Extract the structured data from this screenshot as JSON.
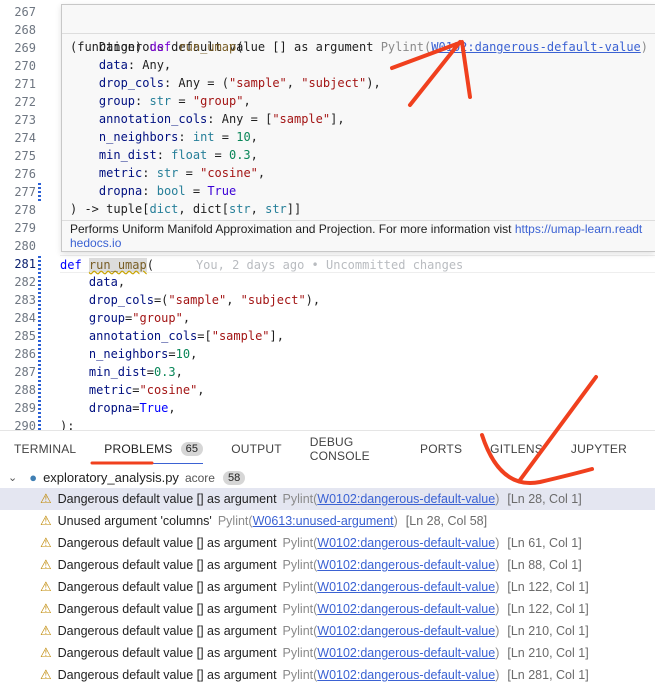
{
  "gutter": {
    "line_numbers": [
      "267",
      "268",
      "269",
      "270",
      "271",
      "272",
      "273",
      "274",
      "275",
      "276",
      "277",
      "278",
      "279",
      "280",
      "281",
      "282",
      "283",
      "284",
      "285",
      "286",
      "287",
      "288",
      "289",
      "290"
    ],
    "current_line": "281"
  },
  "hover": {
    "message": "Dangerous default value [] as argument",
    "source": "Pylint(",
    "code_link": "W0102:dangerous-default-value",
    "source_close": ")",
    "signature": [
      [
        [
          "(function) ",
          "pun"
        ],
        [
          "def",
          "kwh"
        ],
        [
          " ",
          "pun"
        ],
        [
          "run_umap",
          "fn"
        ],
        [
          "(",
          "pun"
        ]
      ],
      [
        [
          "    ",
          "pun"
        ],
        [
          "data",
          "pa"
        ],
        [
          ": Any,",
          "pun"
        ]
      ],
      [
        [
          "    ",
          "pun"
        ],
        [
          "drop_cols",
          "pa"
        ],
        [
          ": Any = (",
          "pun"
        ],
        [
          "\"sample\"",
          "str"
        ],
        [
          ", ",
          "pun"
        ],
        [
          "\"subject\"",
          "str"
        ],
        [
          "),",
          "pun"
        ]
      ],
      [
        [
          "    ",
          "pun"
        ],
        [
          "group",
          "pa"
        ],
        [
          ": ",
          "pun"
        ],
        [
          "str",
          "ty"
        ],
        [
          " = ",
          "pun"
        ],
        [
          "\"group\"",
          "str"
        ],
        [
          ",",
          "pun"
        ]
      ],
      [
        [
          "    ",
          "pun"
        ],
        [
          "annotation_cols",
          "pa"
        ],
        [
          ": Any = [",
          "pun"
        ],
        [
          "\"sample\"",
          "str"
        ],
        [
          "],",
          "pun"
        ]
      ],
      [
        [
          "    ",
          "pun"
        ],
        [
          "n_neighbors",
          "pa"
        ],
        [
          ": ",
          "pun"
        ],
        [
          "int",
          "ty"
        ],
        [
          " = ",
          "pun"
        ],
        [
          "10",
          "num"
        ],
        [
          ",",
          "pun"
        ]
      ],
      [
        [
          "    ",
          "pun"
        ],
        [
          "min_dist",
          "pa"
        ],
        [
          ": ",
          "pun"
        ],
        [
          "float",
          "ty"
        ],
        [
          " = ",
          "pun"
        ],
        [
          "0.3",
          "num"
        ],
        [
          ",",
          "pun"
        ]
      ],
      [
        [
          "    ",
          "pun"
        ],
        [
          "metric",
          "pa"
        ],
        [
          ": ",
          "pun"
        ],
        [
          "str",
          "ty"
        ],
        [
          " = ",
          "pun"
        ],
        [
          "\"cosine\"",
          "str"
        ],
        [
          ",",
          "pun"
        ]
      ],
      [
        [
          "    ",
          "pun"
        ],
        [
          "dropna",
          "pa"
        ],
        [
          ": ",
          "pun"
        ],
        [
          "bool",
          "ty"
        ],
        [
          " = ",
          "pun"
        ],
        [
          "True",
          "tr"
        ]
      ],
      [
        [
          ") -> tuple[",
          "pun"
        ],
        [
          "dict",
          "ty"
        ],
        [
          ", dict[",
          "pun"
        ],
        [
          "str",
          "ty"
        ],
        [
          ", ",
          "pun"
        ],
        [
          "str",
          "ty"
        ],
        [
          "]]",
          "pun"
        ]
      ]
    ],
    "doc_text": "Performs Uniform Manifold Approximation and Projection. For more information vist ",
    "doc_link": "https://umap-learn.readthedocs.io"
  },
  "editor": {
    "lines": [
      [
        [
          "def",
          "kw"
        ],
        [
          " ",
          "pun"
        ],
        [
          "run_umap",
          "fn"
        ],
        [
          "(",
          "pun"
        ]
      ],
      [
        [
          "    ",
          "pun"
        ],
        [
          "data",
          "pa"
        ],
        [
          ",",
          "pun"
        ]
      ],
      [
        [
          "    ",
          "pun"
        ],
        [
          "drop_cols",
          "pa"
        ],
        [
          "=(",
          "pun"
        ],
        [
          "\"sample\"",
          "str"
        ],
        [
          ", ",
          "pun"
        ],
        [
          "\"subject\"",
          "str"
        ],
        [
          "),",
          "pun"
        ]
      ],
      [
        [
          "    ",
          "pun"
        ],
        [
          "group",
          "pa"
        ],
        [
          "=",
          "pun"
        ],
        [
          "\"group\"",
          "str"
        ],
        [
          ",",
          "pun"
        ]
      ],
      [
        [
          "    ",
          "pun"
        ],
        [
          "annotation_cols",
          "pa"
        ],
        [
          "=[",
          "pun"
        ],
        [
          "\"sample\"",
          "str"
        ],
        [
          "],",
          "pun"
        ]
      ],
      [
        [
          "    ",
          "pun"
        ],
        [
          "n_neighbors",
          "pa"
        ],
        [
          "=",
          "pun"
        ],
        [
          "10",
          "num"
        ],
        [
          ",",
          "pun"
        ]
      ],
      [
        [
          "    ",
          "pun"
        ],
        [
          "min_dist",
          "pa"
        ],
        [
          "=",
          "pun"
        ],
        [
          "0.3",
          "num"
        ],
        [
          ",",
          "pun"
        ]
      ],
      [
        [
          "    ",
          "pun"
        ],
        [
          "metric",
          "pa"
        ],
        [
          "=",
          "pun"
        ],
        [
          "\"cosine\"",
          "str"
        ],
        [
          ",",
          "pun"
        ]
      ],
      [
        [
          "    ",
          "pun"
        ],
        [
          "dropna",
          "pa"
        ],
        [
          "=",
          "pun"
        ],
        [
          "True",
          "kw"
        ],
        [
          ",",
          "pun"
        ]
      ],
      [
        [
          "):",
          "pun"
        ]
      ]
    ],
    "blame": "You, 2 days ago • Uncommitted changes"
  },
  "panel": {
    "tabs": [
      {
        "label": "TERMINAL"
      },
      {
        "label": "PROBLEMS",
        "badge": "65",
        "active": true
      },
      {
        "label": "OUTPUT"
      },
      {
        "label": "DEBUG CONSOLE"
      },
      {
        "label": "PORTS"
      },
      {
        "label": "GITLENS"
      },
      {
        "label": "JUPYTER"
      }
    ],
    "file": {
      "name": "exploratory_analysis.py",
      "folder": "acore",
      "count": "58",
      "icon": "python-icon"
    },
    "problems": [
      {
        "message": "Dangerous default value [] as argument",
        "source": "Pylint(",
        "code": "W0102:dangerous-default-value",
        "close": ")",
        "location": "[Ln 28, Col 1]",
        "selected": true
      },
      {
        "message": "Unused argument 'columns'",
        "source": "Pylint(",
        "code": "W0613:unused-argument",
        "close": ")",
        "location": "[Ln 28, Col 58]"
      },
      {
        "message": "Dangerous default value [] as argument",
        "source": "Pylint(",
        "code": "W0102:dangerous-default-value",
        "close": ")",
        "location": "[Ln 61, Col 1]"
      },
      {
        "message": "Dangerous default value [] as argument",
        "source": "Pylint(",
        "code": "W0102:dangerous-default-value",
        "close": ")",
        "location": "[Ln 88, Col 1]"
      },
      {
        "message": "Dangerous default value [] as argument",
        "source": "Pylint(",
        "code": "W0102:dangerous-default-value",
        "close": ")",
        "location": "[Ln 122, Col 1]"
      },
      {
        "message": "Dangerous default value [] as argument",
        "source": "Pylint(",
        "code": "W0102:dangerous-default-value",
        "close": ")",
        "location": "[Ln 122, Col 1]"
      },
      {
        "message": "Dangerous default value [] as argument",
        "source": "Pylint(",
        "code": "W0102:dangerous-default-value",
        "close": ")",
        "location": "[Ln 210, Col 1]"
      },
      {
        "message": "Dangerous default value [] as argument",
        "source": "Pylint(",
        "code": "W0102:dangerous-default-value",
        "close": ")",
        "location": "[Ln 210, Col 1]"
      },
      {
        "message": "Dangerous default value [] as argument",
        "source": "Pylint(",
        "code": "W0102:dangerous-default-value",
        "close": ")",
        "location": "[Ln 281, Col 1]"
      }
    ]
  },
  "colors": {
    "annotation": "#f0401e",
    "link": "#3b62d3",
    "warning": "#bf8803"
  }
}
